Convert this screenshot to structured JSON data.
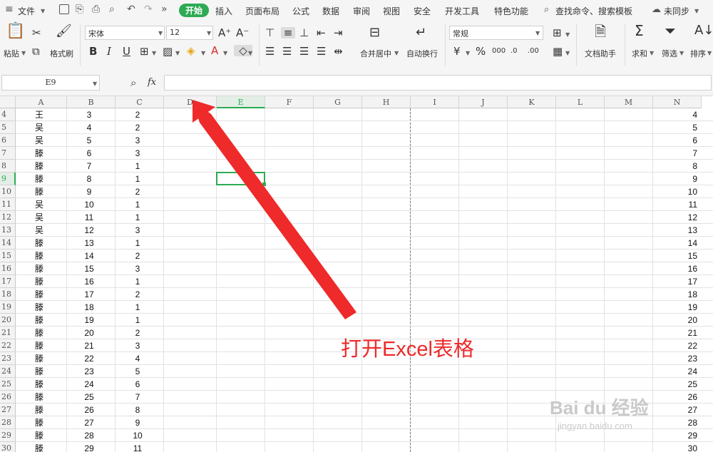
{
  "menubar": {
    "file": "文件",
    "tabs": [
      "开始",
      "插入",
      "页面布局",
      "公式",
      "数据",
      "审阅",
      "视图",
      "安全",
      "开发工具",
      "特色功能"
    ],
    "active_tab": 0,
    "search": "查找命令、搜索模板",
    "sync": "未同步"
  },
  "ribbon": {
    "paste": "粘贴",
    "format_painter": "格式刷",
    "font_name": "宋体",
    "font_size": "12",
    "bold": "B",
    "italic": "I",
    "underline": "U",
    "merge_center": "合并居中",
    "wrap_text": "自动换行",
    "number_format": "常规",
    "doc_helper": "文档助手",
    "sum": "求和",
    "filter": "筛选",
    "sort": "排序"
  },
  "formula_bar": {
    "name_box": "E9",
    "fx": "fx",
    "value": ""
  },
  "sheet": {
    "columns": [
      "A",
      "B",
      "C",
      "D",
      "E",
      "F",
      "G",
      "H",
      "I",
      "J",
      "K",
      "L",
      "M",
      "N"
    ],
    "selected_column": "E",
    "selected_row": 9,
    "rows": [
      {
        "n": "4",
        "a": "王",
        "b": "3",
        "c": "2",
        "n_col": "4"
      },
      {
        "n": "5",
        "a": "吴",
        "b": "4",
        "c": "2",
        "n_col": "5"
      },
      {
        "n": "6",
        "a": "吴",
        "b": "5",
        "c": "3",
        "n_col": "6"
      },
      {
        "n": "7",
        "a": "滕",
        "b": "6",
        "c": "3",
        "n_col": "7"
      },
      {
        "n": "8",
        "a": "滕",
        "b": "7",
        "c": "1",
        "n_col": "8"
      },
      {
        "n": "9",
        "a": "滕",
        "b": "8",
        "c": "1",
        "n_col": "9"
      },
      {
        "n": "10",
        "a": "滕",
        "b": "9",
        "c": "2",
        "n_col": "10"
      },
      {
        "n": "11",
        "a": "吴",
        "b": "10",
        "c": "1",
        "n_col": "11"
      },
      {
        "n": "12",
        "a": "吴",
        "b": "11",
        "c": "1",
        "n_col": "12"
      },
      {
        "n": "13",
        "a": "吴",
        "b": "12",
        "c": "3",
        "n_col": "13"
      },
      {
        "n": "14",
        "a": "滕",
        "b": "13",
        "c": "1",
        "n_col": "14"
      },
      {
        "n": "15",
        "a": "滕",
        "b": "14",
        "c": "2",
        "n_col": "15"
      },
      {
        "n": "16",
        "a": "滕",
        "b": "15",
        "c": "3",
        "n_col": "16"
      },
      {
        "n": "17",
        "a": "滕",
        "b": "16",
        "c": "1",
        "n_col": "17"
      },
      {
        "n": "18",
        "a": "滕",
        "b": "17",
        "c": "2",
        "n_col": "18"
      },
      {
        "n": "19",
        "a": "滕",
        "b": "18",
        "c": "1",
        "n_col": "19"
      },
      {
        "n": "20",
        "a": "滕",
        "b": "19",
        "c": "1",
        "n_col": "20"
      },
      {
        "n": "21",
        "a": "滕",
        "b": "20",
        "c": "2",
        "n_col": "21"
      },
      {
        "n": "22",
        "a": "滕",
        "b": "21",
        "c": "3",
        "n_col": "22"
      },
      {
        "n": "23",
        "a": "滕",
        "b": "22",
        "c": "4",
        "n_col": "23"
      },
      {
        "n": "24",
        "a": "滕",
        "b": "23",
        "c": "5",
        "n_col": "24"
      },
      {
        "n": "25",
        "a": "滕",
        "b": "24",
        "c": "6",
        "n_col": "25"
      },
      {
        "n": "26",
        "a": "滕",
        "b": "25",
        "c": "7",
        "n_col": "26"
      },
      {
        "n": "27",
        "a": "滕",
        "b": "26",
        "c": "8",
        "n_col": "27"
      },
      {
        "n": "28",
        "a": "滕",
        "b": "27",
        "c": "9",
        "n_col": "28"
      },
      {
        "n": "29",
        "a": "滕",
        "b": "28",
        "c": "10",
        "n_col": "29"
      },
      {
        "n": "30",
        "a": "滕",
        "b": "29",
        "c": "11",
        "n_col": "30"
      }
    ]
  },
  "annotation": {
    "text": "打开Excel表格",
    "color": "#ee2a2a"
  },
  "watermark": {
    "brand": "Bai du 经验",
    "url": "jingyan.baidu.com"
  },
  "colors": {
    "accent": "#2daa53"
  }
}
